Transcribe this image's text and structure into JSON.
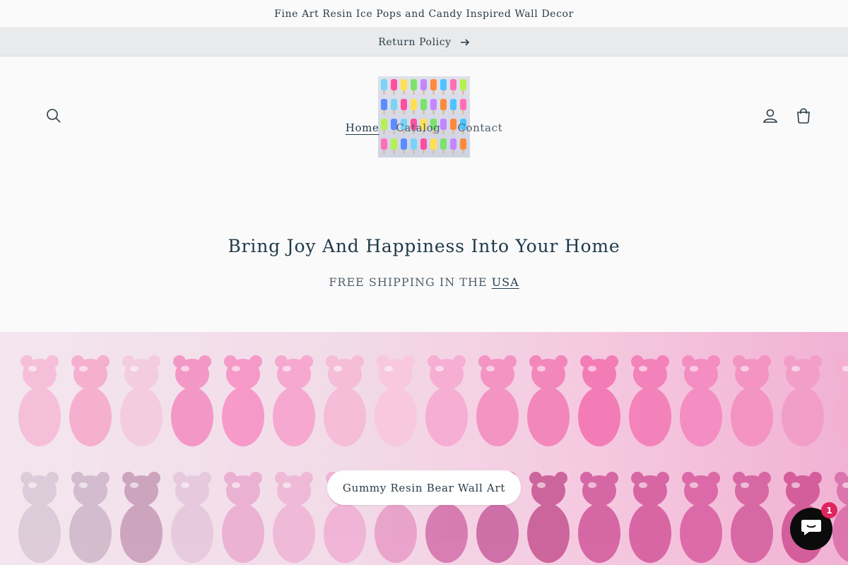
{
  "announcement": {
    "text": "Fine Art Resin Ice Pops and Candy Inspired Wall Decor"
  },
  "return_bar": {
    "label": "Return Policy",
    "arrow_icon": "arrow-right-icon"
  },
  "header": {
    "search_icon": "search-icon",
    "account_icon": "account-icon",
    "cart_icon": "cart-icon",
    "logo_alt": "ice pop wall art logo"
  },
  "nav": {
    "items": [
      {
        "label": "Home",
        "active": true
      },
      {
        "label": "Catalog",
        "active": false
      },
      {
        "label": "Contact",
        "active": false
      }
    ]
  },
  "hero": {
    "title": "Bring Joy And Happiness Into Your Home",
    "subtitle_prefix": "FREE SHIPPING IN THE ",
    "subtitle_link": "USA"
  },
  "banner": {
    "button_label": "Gummy Resin Bear Wall Art",
    "image_subject": "rows of pink gummy resin bears"
  },
  "chat": {
    "badge_count": "1",
    "icon": "chat-icon"
  },
  "colors": {
    "text": "#1f3a4a",
    "return_bar_bg": "#e8eaeb",
    "chat_bg": "#0b0b0b",
    "badge_bg": "#e0245e"
  }
}
